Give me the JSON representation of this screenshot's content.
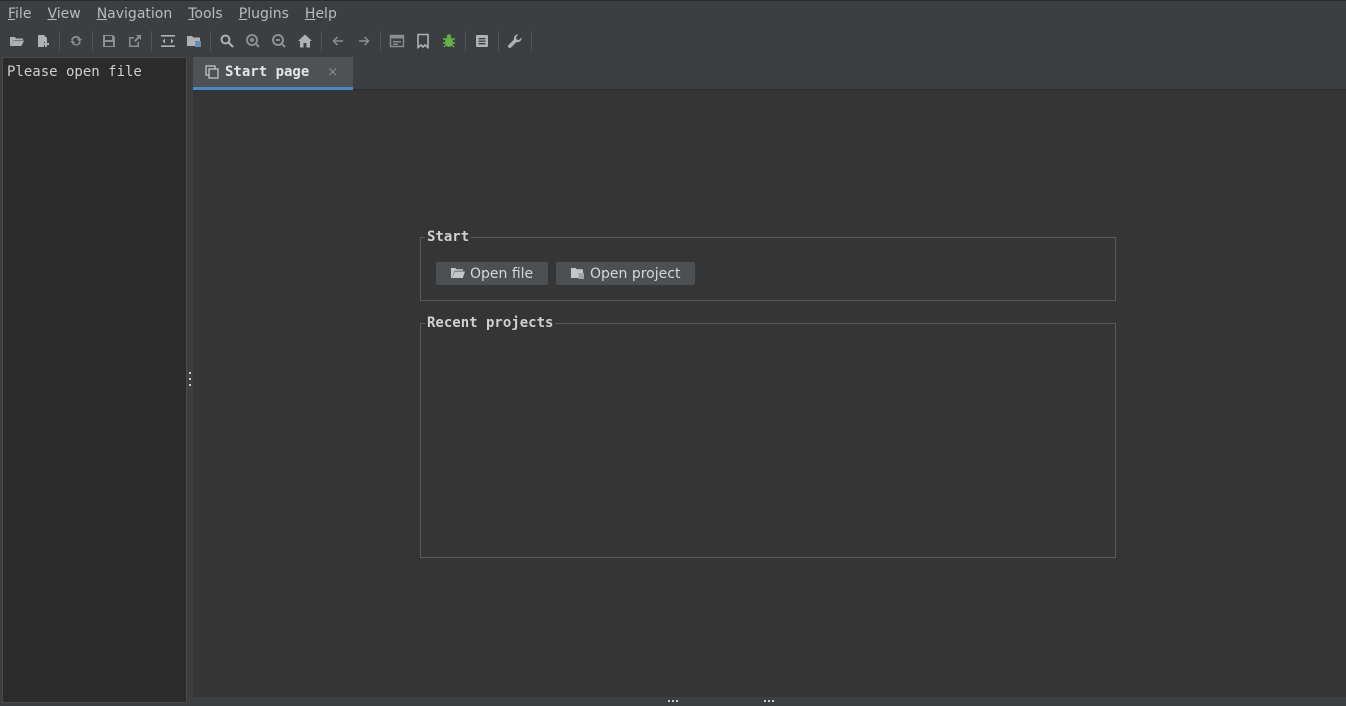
{
  "menubar": {
    "items": [
      {
        "mnemonic": "F",
        "rest": "ile"
      },
      {
        "mnemonic": "V",
        "rest": "iew"
      },
      {
        "mnemonic": "N",
        "rest": "avigation"
      },
      {
        "mnemonic": "T",
        "rest": "ools"
      },
      {
        "mnemonic": "P",
        "rest": "lugins"
      },
      {
        "mnemonic": "H",
        "rest": "elp"
      }
    ]
  },
  "toolbar": {
    "icons": [
      "open-folder-icon",
      "add-file-icon",
      "reload-icon",
      "save-icon",
      "export-icon",
      "decompile-icon",
      "open-project-icon",
      "search-icon",
      "search-usage-icon",
      "search-text-icon",
      "home-icon",
      "back-arrow-icon",
      "forward-arrow-icon",
      "log-icon",
      "bookmark-icon",
      "debug-bug-icon",
      "show-log-icon",
      "preferences-wrench-icon"
    ],
    "accent_bug": "#62b543"
  },
  "left_panel": {
    "message": "Please open file"
  },
  "tabs": [
    {
      "label": "Start page",
      "close": "×"
    }
  ],
  "start_group": {
    "title": "Start",
    "open_file_label": "Open file",
    "open_project_label": "Open project"
  },
  "recent_group": {
    "title": "Recent projects"
  },
  "colors": {
    "background": "#3c3f41",
    "content": "#353535",
    "tab_accent": "#4a88c7"
  }
}
